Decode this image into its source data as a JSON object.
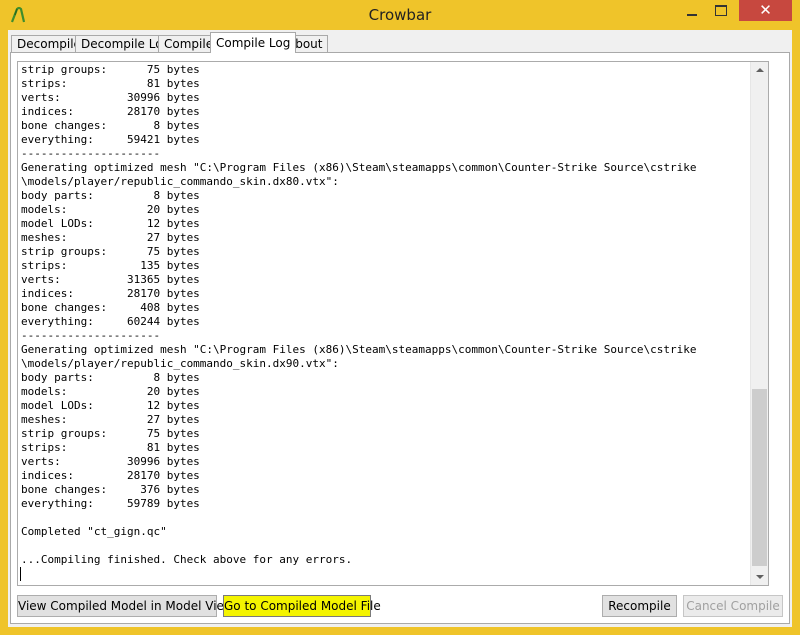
{
  "window": {
    "title": "Crowbar",
    "close_glyph": "✕"
  },
  "tabs": [
    {
      "label": "Decompiler",
      "active": false
    },
    {
      "label": "Decompile Log",
      "active": false
    },
    {
      "label": "Compiler",
      "active": false
    },
    {
      "label": "Compile Log",
      "active": true
    },
    {
      "label": "About",
      "active": false
    }
  ],
  "log": {
    "lines": [
      "strip groups:      75 bytes",
      "strips:            81 bytes",
      "verts:          30996 bytes",
      "indices:        28170 bytes",
      "bone changes:       8 bytes",
      "everything:     59421 bytes",
      "---------------------",
      "Generating optimized mesh \"C:\\Program Files (x86)\\Steam\\steamapps\\common\\Counter-Strike Source\\cstrike",
      "\\models/player/republic_commando_skin.dx80.vtx\":",
      "body parts:         8 bytes",
      "models:            20 bytes",
      "model LODs:        12 bytes",
      "meshes:            27 bytes",
      "strip groups:      75 bytes",
      "strips:           135 bytes",
      "verts:          31365 bytes",
      "indices:        28170 bytes",
      "bone changes:     408 bytes",
      "everything:     60244 bytes",
      "---------------------",
      "Generating optimized mesh \"C:\\Program Files (x86)\\Steam\\steamapps\\common\\Counter-Strike Source\\cstrike",
      "\\models/player/republic_commando_skin.dx90.vtx\":",
      "body parts:         8 bytes",
      "models:            20 bytes",
      "model LODs:        12 bytes",
      "meshes:            27 bytes",
      "strip groups:      75 bytes",
      "strips:            81 bytes",
      "verts:          30996 bytes",
      "indices:        28170 bytes",
      "bone changes:     376 bytes",
      "everything:     59789 bytes",
      "",
      "Completed \"ct_gign.qc\"",
      "",
      "...Compiling finished. Check above for any errors."
    ]
  },
  "buttons": {
    "view_model": "View Compiled Model in Model Viewer",
    "goto_file": "Go to Compiled Model File",
    "recompile": "Recompile",
    "cancel_compile": "Cancel Compile"
  },
  "colors": {
    "title_bar": "#efc42a",
    "close_button": "#c7483f",
    "highlight_button": "#f4f400"
  },
  "icons": {
    "app": "crowbar-logo-icon",
    "minimize": "minimize-icon",
    "maximize": "maximize-icon",
    "close": "close-icon"
  }
}
